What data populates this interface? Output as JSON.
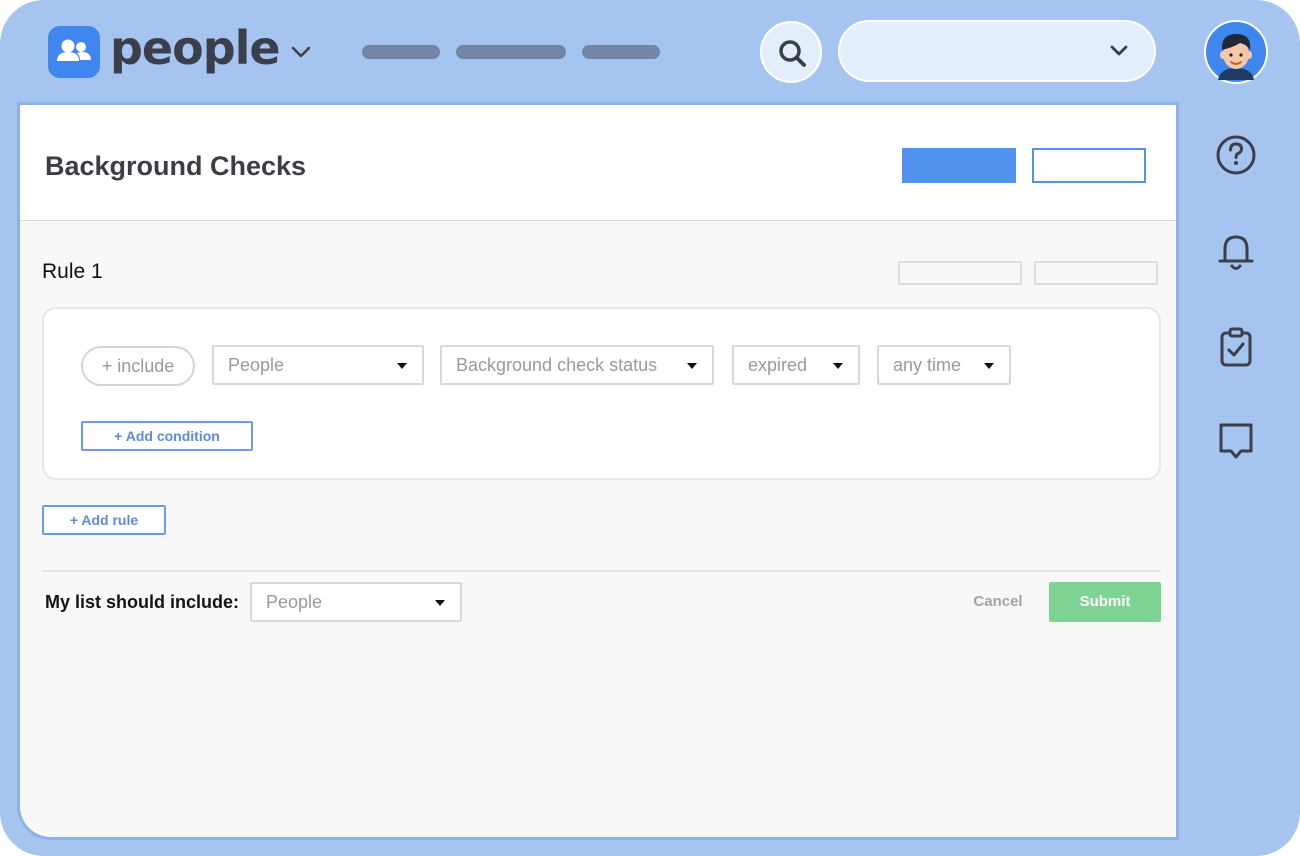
{
  "app": {
    "name": "people",
    "logo_icon": "users-icon",
    "switcher_icon": "chevron-down-icon"
  },
  "header": {
    "search_icon": "search-icon",
    "selector": {
      "value": "",
      "icon": "chevron-down-icon"
    },
    "avatar_icon": "user-avatar"
  },
  "rail": {
    "items": [
      "help-icon",
      "bell-icon",
      "clipboard-check-icon",
      "chat-icon"
    ]
  },
  "page": {
    "title": "Background Checks"
  },
  "rule": {
    "title": "Rule 1",
    "include_label": "+ include",
    "conditions": [
      {
        "value": "People"
      },
      {
        "value": "Background check status"
      },
      {
        "value": "expired"
      },
      {
        "value": "any time"
      }
    ],
    "add_condition_label": "+ Add condition"
  },
  "add_rule_label": "+ Add rule",
  "footer": {
    "list_label": "My list should include:",
    "list_select": "People",
    "cancel_label": "Cancel",
    "submit_label": "Submit"
  },
  "colors": {
    "frame": "#a5c4ef",
    "accent": "#5192ee",
    "submit": "#7ed392",
    "logo": "#3f87ef"
  }
}
